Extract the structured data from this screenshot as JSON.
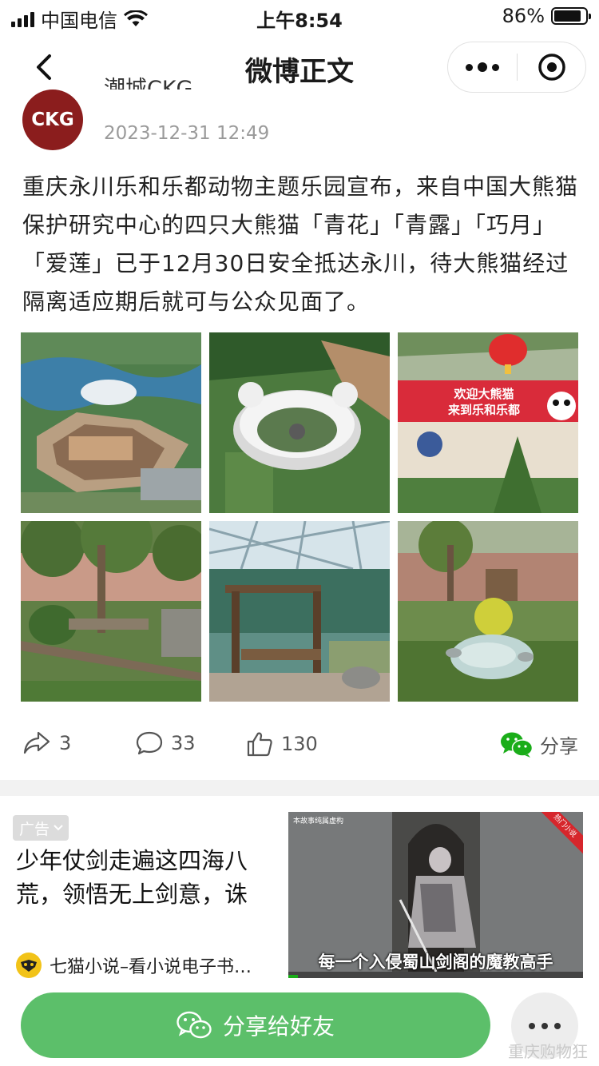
{
  "status_bar": {
    "carrier": "中国电信",
    "time": "上午8:54",
    "battery": "86%",
    "battery_level": 0.86
  },
  "nav": {
    "title": "微博正文"
  },
  "post": {
    "avatar_text": "CKG",
    "author": "潮城CKG",
    "time": "2023-12-31 12:49",
    "text": "重庆永川乐和乐都动物主题乐园宣布，来自中国大熊猫保护研究中心的四只大熊猫「青花」「青露」「巧月」「爱莲」已于12月30日安全抵达永川，待大熊猫经过隔离适应期后就可与公众见面了。",
    "images": [
      {
        "name": "aerial-park-photo"
      },
      {
        "name": "panda-house-aerial-photo"
      },
      {
        "name": "welcome-banner-photo",
        "banner_line1": "欢迎大熊猫",
        "banner_line2": "来到乐和乐都"
      },
      {
        "name": "panda-enclosure-garden-photo"
      },
      {
        "name": "indoor-wooden-platform-photo"
      },
      {
        "name": "enclosure-pond-photo"
      }
    ]
  },
  "actions": {
    "repost_count": "3",
    "comment_count": "33",
    "like_count": "130",
    "share_label": "分享"
  },
  "ad": {
    "tag": "广告",
    "title": "少年仗剑走遍这四海八荒，领悟无上剑意，诛",
    "video_caption": "每一个入侵蜀山剑阁的魔教高手",
    "video_small_text": "本故事纯属虚构",
    "video_ribbon": "热门小说",
    "source": "七猫小说–看小说电子书…"
  },
  "bottom": {
    "share_button": "分享给好友",
    "watermark": "重庆购物狂"
  },
  "colors": {
    "share_green": "#5cbf6a",
    "wechat_green": "#1aad19",
    "avatar_red": "#8b1d1d",
    "banner_red": "#d92b3a"
  }
}
